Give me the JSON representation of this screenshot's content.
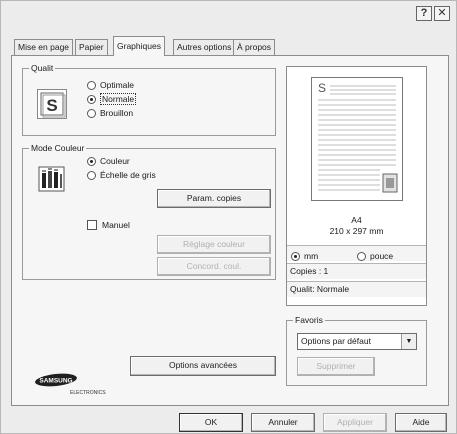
{
  "titlebar": {
    "help": "?",
    "close": "✕"
  },
  "tabs": [
    {
      "label": "Mise en page"
    },
    {
      "label": "Papier"
    },
    {
      "label": "Graphiques"
    },
    {
      "label": "Autres options"
    },
    {
      "label": "À propos"
    }
  ],
  "quality": {
    "title": "Qualit",
    "icon_letter": "S",
    "options": [
      {
        "label": "Optimale",
        "selected": false
      },
      {
        "label": "Normale",
        "selected": true
      },
      {
        "label": "Brouillon",
        "selected": false
      }
    ]
  },
  "color_mode": {
    "title": "Mode Couleur",
    "options": [
      {
        "label": "Couleur",
        "selected": true
      },
      {
        "label": "Échelle de gris",
        "selected": false
      }
    ],
    "copy_settings_label": "Param. copies",
    "manual_label": "Manuel",
    "color_adjust_label": "Réglage couleur",
    "color_match_label": "Concord. coul."
  },
  "advanced_options_label": "Options avancées",
  "logo": {
    "brand": "SAMSUNG",
    "sub": "ELECTRONICS"
  },
  "preview": {
    "page_letter": "S",
    "paper_name": "A4",
    "paper_size": "210 x 297 mm",
    "unit_mm": "mm",
    "unit_inch": "pouce",
    "copies": "Copies : 1",
    "quality": "Qualit: Normale"
  },
  "favorites": {
    "title": "Favoris",
    "selected": "Options par défaut",
    "delete_label": "Supprimer"
  },
  "footer": {
    "ok": "OK",
    "cancel": "Annuler",
    "apply": "Appliquer",
    "help": "Aide"
  }
}
